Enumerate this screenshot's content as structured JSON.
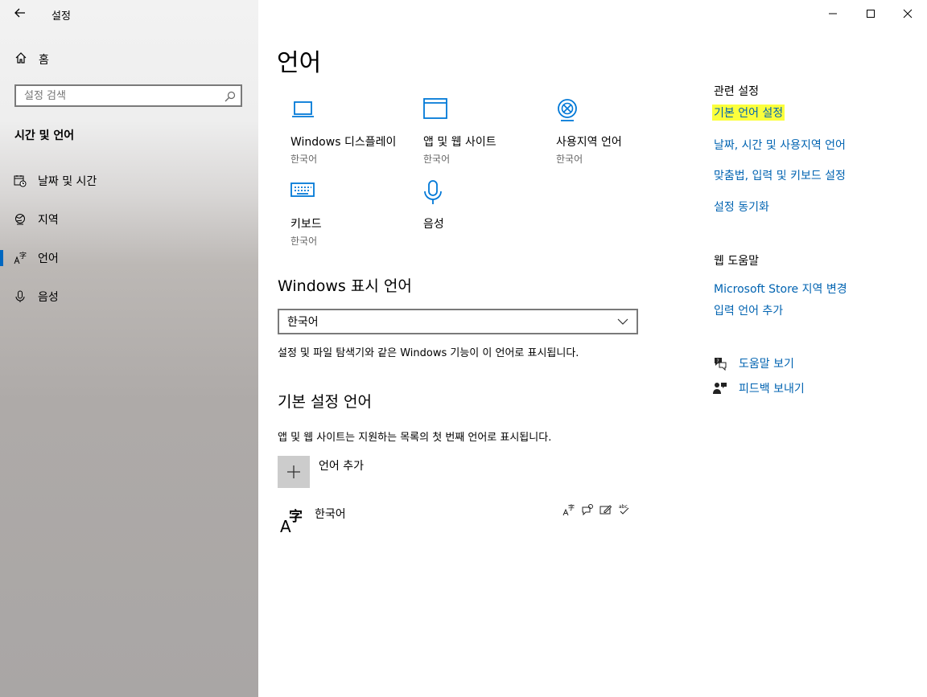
{
  "app": {
    "title": "설정"
  },
  "sidebar": {
    "home_label": "홈",
    "search_placeholder": "설정 검색",
    "section_title": "시간 및 언어",
    "items": [
      {
        "label": "날짜 및 시간",
        "icon": "calendar-clock-icon"
      },
      {
        "label": "지역",
        "icon": "globe-region-icon"
      },
      {
        "label": "언어",
        "icon": "language-icon",
        "active": true
      },
      {
        "label": "음성",
        "icon": "microphone-icon"
      }
    ]
  },
  "main": {
    "title": "언어",
    "tiles": [
      {
        "name": "Windows 디스플레이",
        "sub": "한국어",
        "icon": "laptop-icon"
      },
      {
        "name": "앱 및 웹 사이트",
        "sub": "한국어",
        "icon": "window-icon"
      },
      {
        "name": "사용지역 언어",
        "sub": "한국어",
        "icon": "globe-icon"
      },
      {
        "name": "키보드",
        "sub": "한국어",
        "icon": "keyboard-icon"
      },
      {
        "name": "음성",
        "sub": "",
        "icon": "microphone-icon"
      }
    ],
    "display_language": {
      "heading": "Windows 표시 언어",
      "selected": "한국어",
      "description": "설정 및 파일 탐색기와 같은 Windows 기능이 이 언어로 표시됩니다."
    },
    "preferred": {
      "heading": "기본 설정 언어",
      "description": "앱 및 웹 사이트는 지원하는 목록의 첫 번째 언어로 표시됩니다.",
      "add_label": "언어 추가",
      "languages": [
        {
          "name": "한국어"
        }
      ]
    }
  },
  "right": {
    "related_title": "관련 설정",
    "related_links": [
      "기본 언어 설정",
      "날짜, 시간 및 사용지역 언어",
      "맞춤법, 입력 및 키보드 설정",
      "설정 동기화"
    ],
    "help_title": "웹 도움말",
    "help_links": [
      "Microsoft Store 지역 변경",
      "입력 언어 추가"
    ],
    "get_help": "도움말 보기",
    "feedback": "피드백 보내기"
  },
  "colors": {
    "accent": "#0078d7",
    "link": "#0063b1",
    "highlight": "#fbff3c"
  }
}
